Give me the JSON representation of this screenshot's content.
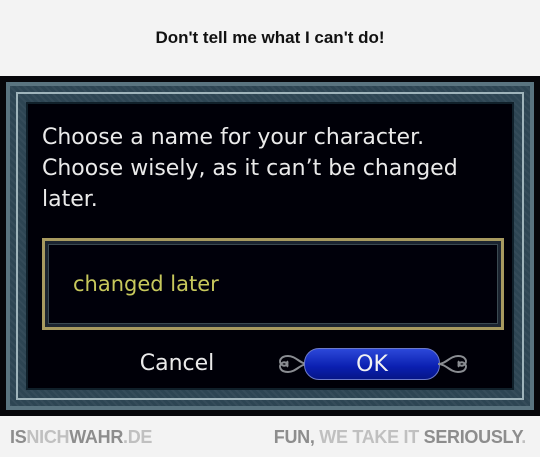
{
  "meme": {
    "title": "Don't tell me what I can't do!"
  },
  "dialog": {
    "prompt_lines": [
      "Choose a name for your character.",
      "Choose wisely, as it can’t be changed",
      "later."
    ],
    "name_input_value": "changed later",
    "cancel_label": "Cancel",
    "ok_label": "OK"
  },
  "footer": {
    "site_part1": "IS",
    "site_part2": "NICH",
    "site_part3": "WAHR",
    "site_part4": ".DE",
    "slogan_part1": "FUN,",
    "slogan_part2": " WE TAKE IT ",
    "slogan_part3": "SERIOUSLY",
    "slogan_part4": "."
  },
  "icons": {
    "ok_left_ornament": "scroll-ornament-icon",
    "ok_right_ornament": "scroll-ornament-icon"
  },
  "colors": {
    "dialog_bg": "#00000a",
    "frame": "#2d4553",
    "input_border": "#a79a60",
    "input_text": "#c7c85c",
    "ok_button": "#0a1fb0"
  }
}
